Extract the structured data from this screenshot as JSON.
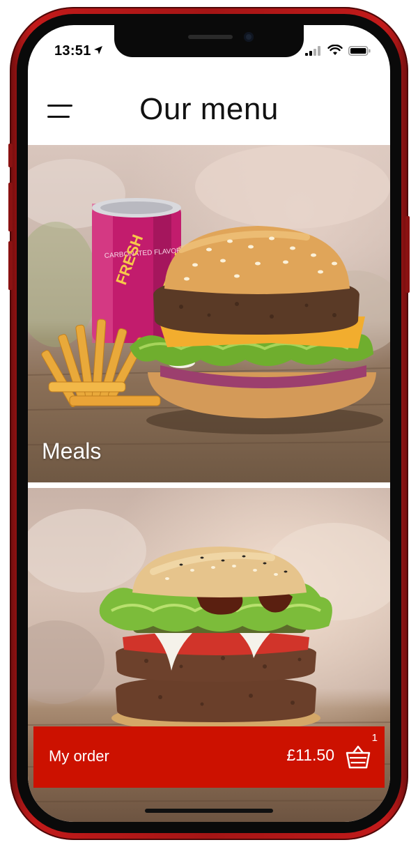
{
  "status_bar": {
    "time": "13:51"
  },
  "header": {
    "title": "Our menu"
  },
  "categories": [
    {
      "label": "Meals"
    },
    {
      "label": ""
    }
  ],
  "order_bar": {
    "label": "My order",
    "total": "£11.50",
    "item_count": "1"
  },
  "colors": {
    "accent": "#cc1100",
    "phone_frame": "#a61616"
  },
  "icons": {
    "menu": "hamburger-menu-icon",
    "basket": "basket-icon",
    "location": "location-arrow-icon",
    "signal": "cellular-signal-icon",
    "wifi": "wifi-icon",
    "battery": "battery-icon"
  }
}
